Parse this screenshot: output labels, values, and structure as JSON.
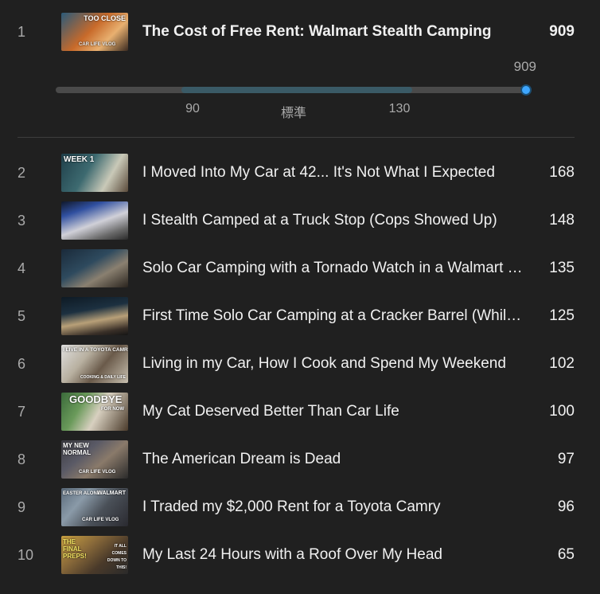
{
  "top": {
    "rank": "1",
    "title": "The Cost of Free Rent: Walmart Stealth Camping",
    "count": "909",
    "thumb_texts": [
      "TOO CLOSE",
      "CAR LIFE VLOG"
    ]
  },
  "range": {
    "max_label": "909",
    "low_label": "90",
    "mid_label": "標準",
    "high_label": "130",
    "track_max": 909,
    "fill_low": 90,
    "fill_high": 130,
    "current": 909,
    "accent_color": "#3ea6ff"
  },
  "rows": [
    {
      "rank": "2",
      "title": "I Moved Into My Car at 42... It's Not What I Expected",
      "count": "168",
      "thumb_texts": [
        "WEEK 1"
      ]
    },
    {
      "rank": "3",
      "title": "I Stealth Camped at a Truck Stop (Cops Showed Up)",
      "count": "148",
      "thumb_texts": []
    },
    {
      "rank": "4",
      "title": "Solo Car Camping with a Tornado Watch in a Walmart Parking Lot",
      "count": "135",
      "thumb_texts": []
    },
    {
      "rank": "5",
      "title": "First Time Solo Car Camping at a Cracker Barrel (While It Rains)",
      "count": "125",
      "thumb_texts": []
    },
    {
      "rank": "6",
      "title": "Living in my Car, How I Cook and Spend My Weekend",
      "count": "102",
      "thumb_texts": [
        "I LIVE IN A TOYOTA CAMRY",
        "COOKING & DAILY LIFE"
      ]
    },
    {
      "rank": "7",
      "title": "My Cat Deserved Better Than Car Life",
      "count": "100",
      "thumb_texts": [
        "GOODBYE",
        "FOR NOW"
      ]
    },
    {
      "rank": "8",
      "title": "The American Dream is Dead",
      "count": "97",
      "thumb_texts": [
        "MY NEW NORMAL",
        "CAR LIFE VLOG"
      ]
    },
    {
      "rank": "9",
      "title": "I Traded my $2,000 Rent for a Toyota Camry",
      "count": "96",
      "thumb_texts": [
        "EASTER ALONE",
        "WALMART",
        "CAR LIFE VLOG"
      ]
    },
    {
      "rank": "10",
      "title": "My Last 24 Hours with a Roof Over My Head",
      "count": "65",
      "thumb_texts": [
        "THE FINAL PREPS!",
        "IT ALL COMES DOWN TO THIS!"
      ]
    }
  ]
}
